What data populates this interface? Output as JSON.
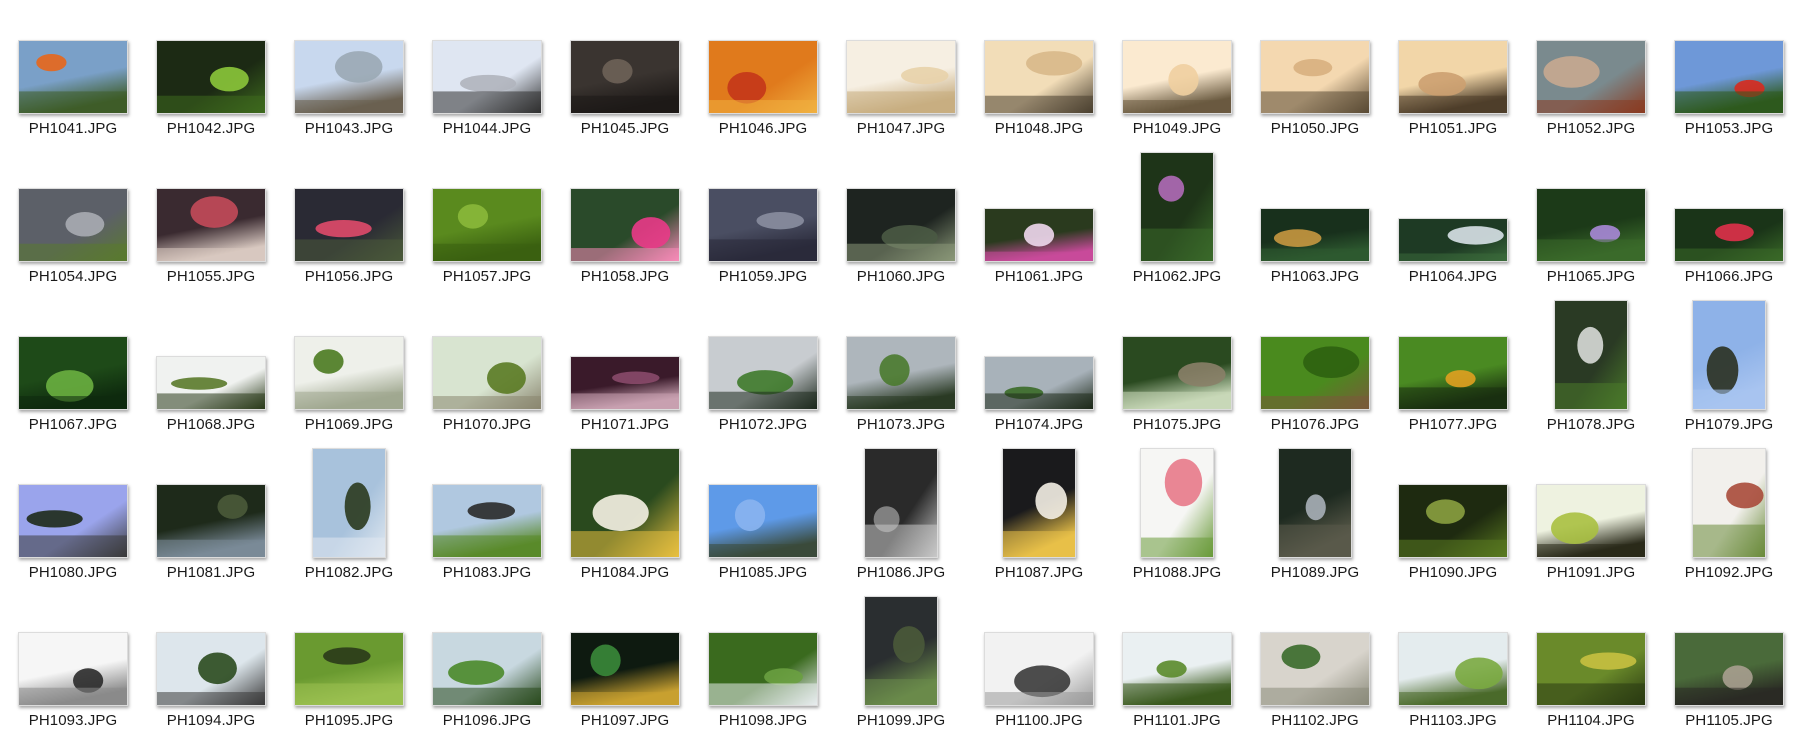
{
  "files": [
    {
      "name": "PH1041.JPG",
      "orientation": "landscape",
      "colors": [
        "#7aa0c8",
        "#e8661a",
        "#3e5c28"
      ]
    },
    {
      "name": "PH1042.JPG",
      "orientation": "landscape",
      "colors": [
        "#1c2a14",
        "#8cc83a",
        "#3e6a1e"
      ]
    },
    {
      "name": "PH1043.JPG",
      "orientation": "landscape",
      "colors": [
        "#c8d8ee",
        "#9aa8b4",
        "#6a6050"
      ]
    },
    {
      "name": "PH1044.JPG",
      "orientation": "landscape",
      "colors": [
        "#dfe6f2",
        "#b0b4bc",
        "#303030"
      ]
    },
    {
      "name": "PH1045.JPG",
      "orientation": "landscape",
      "colors": [
        "#3a3430",
        "#6e6258",
        "#1e1a18"
      ]
    },
    {
      "name": "PH1046.JPG",
      "orientation": "landscape",
      "colors": [
        "#e07a1c",
        "#c4361a",
        "#f0b040"
      ]
    },
    {
      "name": "PH1047.JPG",
      "orientation": "landscape",
      "colors": [
        "#f6efe2",
        "#e8d2aa",
        "#c8ae82"
      ]
    },
    {
      "name": "PH1048.JPG",
      "orientation": "landscape",
      "colors": [
        "#f2ddb8",
        "#d8b88a",
        "#4a4030"
      ]
    },
    {
      "name": "PH1049.JPG",
      "orientation": "landscape",
      "colors": [
        "#fbead0",
        "#efcfa0",
        "#6a5a40"
      ]
    },
    {
      "name": "PH1050.JPG",
      "orientation": "landscape",
      "colors": [
        "#f4d8b0",
        "#d8b080",
        "#5a4a34"
      ]
    },
    {
      "name": "PH1051.JPG",
      "orientation": "landscape",
      "colors": [
        "#f2d6a8",
        "#cca070",
        "#4e3e2a"
      ]
    },
    {
      "name": "PH1052.JPG",
      "orientation": "landscape",
      "colors": [
        "#7a8a8e",
        "#c8a890",
        "#8a3a20"
      ]
    },
    {
      "name": "PH1053.JPG",
      "orientation": "landscape",
      "colors": [
        "#6e98d8",
        "#d82a1e",
        "#2e5a1e"
      ]
    },
    {
      "name": "PH1054.JPG",
      "orientation": "landscape",
      "colors": [
        "#5c6068",
        "#a8acb2",
        "#5a7a2e"
      ]
    },
    {
      "name": "PH1055.JPG",
      "orientation": "landscape",
      "colors": [
        "#3a2a30",
        "#c44a5a",
        "#d8c8c0"
      ]
    },
    {
      "name": "PH1056.JPG",
      "orientation": "landscape",
      "colors": [
        "#2a2a34",
        "#e04a6a",
        "#4a5a3a"
      ]
    },
    {
      "name": "PH1057.JPG",
      "orientation": "landscape",
      "colors": [
        "#5a8a1e",
        "#8ab83a",
        "#3a6010"
      ]
    },
    {
      "name": "PH1058.JPG",
      "orientation": "landscape",
      "colors": [
        "#2a4a2a",
        "#ea3a88",
        "#f88ab8"
      ]
    },
    {
      "name": "PH1059.JPG",
      "orientation": "landscape",
      "colors": [
        "#4a4e62",
        "#8a8ea0",
        "#2a2a3a"
      ]
    },
    {
      "name": "PH1060.JPG",
      "orientation": "landscape",
      "colors": [
        "#1e2420",
        "#4a5a44",
        "#8a9878"
      ]
    },
    {
      "name": "PH1061.JPG",
      "orientation": "landscape-short",
      "colors": [
        "#2a3a1e",
        "#f0d8ee",
        "#c84a9a"
      ]
    },
    {
      "name": "PH1062.JPG",
      "orientation": "portrait",
      "colors": [
        "#1e3418",
        "#b06ab8",
        "#3a6a2a"
      ]
    },
    {
      "name": "PH1063.JPG",
      "orientation": "landscape-short",
      "colors": [
        "#18301c",
        "#c89840",
        "#2e5a30"
      ]
    },
    {
      "name": "PH1064.JPG",
      "orientation": "landscape-xshort",
      "colors": [
        "#1e3a24",
        "#d8e2e8",
        "#3a6a3a"
      ]
    },
    {
      "name": "PH1065.JPG",
      "orientation": "landscape",
      "colors": [
        "#1c3a18",
        "#a888d8",
        "#3a6a2a"
      ]
    },
    {
      "name": "PH1066.JPG",
      "orientation": "landscape-short",
      "colors": [
        "#1a3418",
        "#e0304a",
        "#3a6a28"
      ]
    },
    {
      "name": "PH1067.JPG",
      "orientation": "landscape",
      "colors": [
        "#1e4a18",
        "#6ab040",
        "#0e2a0e"
      ]
    },
    {
      "name": "PH1068.JPG",
      "orientation": "landscape-short",
      "colors": [
        "#f0f2f0",
        "#5a7a2a",
        "#2a3a1a"
      ]
    },
    {
      "name": "PH1069.JPG",
      "orientation": "landscape",
      "colors": [
        "#eef0ea",
        "#4a7a20",
        "#a0a890"
      ]
    },
    {
      "name": "PH1070.JPG",
      "orientation": "landscape",
      "colors": [
        "#d8e4d0",
        "#5a7a22",
        "#8a8670"
      ]
    },
    {
      "name": "PH1071.JPG",
      "orientation": "landscape-short",
      "colors": [
        "#3a1a2a",
        "#8a4a6a",
        "#c8a0b0"
      ]
    },
    {
      "name": "PH1072.JPG",
      "orientation": "landscape",
      "colors": [
        "#c8ccd0",
        "#3e7a2a",
        "#1e2a1e"
      ]
    },
    {
      "name": "PH1073.JPG",
      "orientation": "landscape",
      "colors": [
        "#aeb6bc",
        "#4a7a2e",
        "#2a3a24"
      ]
    },
    {
      "name": "PH1074.JPG",
      "orientation": "landscape-short",
      "colors": [
        "#a8b2ba",
        "#3a6a28",
        "#1e2a1a"
      ]
    },
    {
      "name": "PH1075.JPG",
      "orientation": "landscape",
      "colors": [
        "#2a4a20",
        "#8a8068",
        "#c8d8b8"
      ]
    },
    {
      "name": "PH1076.JPG",
      "orientation": "landscape",
      "colors": [
        "#4a8a1e",
        "#2e6010",
        "#7a5a3a"
      ]
    },
    {
      "name": "PH1077.JPG",
      "orientation": "landscape",
      "colors": [
        "#4a8a22",
        "#e0a020",
        "#1a3010"
      ]
    },
    {
      "name": "PH1078.JPG",
      "orientation": "portrait",
      "colors": [
        "#2a3a24",
        "#d8dcd8",
        "#4a7a2a"
      ]
    },
    {
      "name": "PH1079.JPG",
      "orientation": "portrait",
      "colors": [
        "#8eb2e8",
        "#2a3020",
        "#a8c4f0"
      ]
    },
    {
      "name": "PH1080.JPG",
      "orientation": "landscape",
      "colors": [
        "#9aa4ec",
        "#1e2a1a",
        "#3a3a3a"
      ]
    },
    {
      "name": "PH1081.JPG",
      "orientation": "landscape",
      "colors": [
        "#1e2a1a",
        "#4a5a3a",
        "#7a8a98"
      ]
    },
    {
      "name": "PH1082.JPG",
      "orientation": "portrait",
      "colors": [
        "#a8c2dc",
        "#2a3a1e",
        "#e0e8f0"
      ]
    },
    {
      "name": "PH1083.JPG",
      "orientation": "landscape",
      "colors": [
        "#b0c8e0",
        "#2a2a2a",
        "#5a8a2a"
      ]
    },
    {
      "name": "PH1084.JPG",
      "orientation": "square",
      "colors": [
        "#2a4a1e",
        "#f6f2e4",
        "#e8c040"
      ]
    },
    {
      "name": "PH1085.JPG",
      "orientation": "landscape",
      "colors": [
        "#5e9ae8",
        "#8ab4f0",
        "#3a4a3a"
      ]
    },
    {
      "name": "PH1086.JPG",
      "orientation": "portrait",
      "colors": [
        "#2a2a2a",
        "#8a8a8a",
        "#c8c8c8"
      ]
    },
    {
      "name": "PH1087.JPG",
      "orientation": "portrait",
      "colors": [
        "#1a1a1c",
        "#f4f0e6",
        "#e8c048"
      ]
    },
    {
      "name": "PH1088.JPG",
      "orientation": "portrait",
      "colors": [
        "#f6f6f4",
        "#e87a8a",
        "#6a9a3a"
      ]
    },
    {
      "name": "PH1089.JPG",
      "orientation": "portrait",
      "colors": [
        "#1e2a20",
        "#a8b0b8",
        "#5a5a4a"
      ]
    },
    {
      "name": "PH1090.JPG",
      "orientation": "landscape",
      "colors": [
        "#1e2a10",
        "#8aa040",
        "#5a7a20"
      ]
    },
    {
      "name": "PH1091.JPG",
      "orientation": "landscape",
      "colors": [
        "#eef2e0",
        "#a8c040",
        "#2a2a1a"
      ]
    },
    {
      "name": "PH1092.JPG",
      "orientation": "portrait",
      "colors": [
        "#f2f0ec",
        "#a84a3a",
        "#6a8a3a"
      ]
    },
    {
      "name": "PH1093.JPG",
      "orientation": "landscape",
      "colors": [
        "#f6f6f6",
        "#2a2a2a",
        "#8a8a8a"
      ]
    },
    {
      "name": "PH1094.JPG",
      "orientation": "landscape",
      "colors": [
        "#dde6ec",
        "#2a4a1e",
        "#3a3a3a"
      ]
    },
    {
      "name": "PH1095.JPG",
      "orientation": "landscape",
      "colors": [
        "#6a9a30",
        "#2a3a1a",
        "#9ac050"
      ]
    },
    {
      "name": "PH1096.JPG",
      "orientation": "landscape",
      "colors": [
        "#c8d8e0",
        "#4a8a2a",
        "#2a4a1e"
      ]
    },
    {
      "name": "PH1097.JPG",
      "orientation": "landscape",
      "colors": [
        "#0e1a10",
        "#3a8a3a",
        "#c8a030"
      ]
    },
    {
      "name": "PH1098.JPG",
      "orientation": "landscape",
      "colors": [
        "#3a6a1e",
        "#6aa040",
        "#e8ecef"
      ]
    },
    {
      "name": "PH1099.JPG",
      "orientation": "portrait",
      "colors": [
        "#2a2e30",
        "#4a5a3a",
        "#6a8a4a"
      ]
    },
    {
      "name": "PH1100.JPG",
      "orientation": "landscape",
      "colors": [
        "#f2f2f2",
        "#3a3a3a",
        "#9a9a9a"
      ]
    },
    {
      "name": "PH1101.JPG",
      "orientation": "landscape",
      "colors": [
        "#eaf0f2",
        "#5a8a2a",
        "#3a5a1e"
      ]
    },
    {
      "name": "PH1102.JPG",
      "orientation": "landscape",
      "colors": [
        "#d8d4cc",
        "#3a6a2a",
        "#8a8a7a"
      ]
    },
    {
      "name": "PH1103.JPG",
      "orientation": "landscape",
      "colors": [
        "#e4ecee",
        "#7aaa40",
        "#4a6a2a"
      ]
    },
    {
      "name": "PH1104.JPG",
      "orientation": "landscape",
      "colors": [
        "#6a8a2a",
        "#c8c040",
        "#2a3a12"
      ]
    },
    {
      "name": "PH1105.JPG",
      "orientation": "landscape",
      "colors": [
        "#4a6a3a",
        "#a8a090",
        "#2a2a24"
      ]
    }
  ]
}
